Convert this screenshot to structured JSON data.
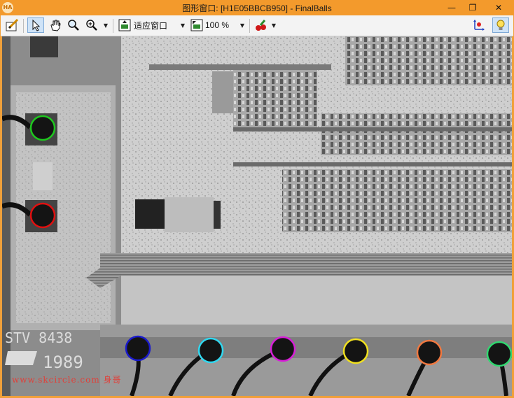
{
  "window": {
    "title": "图形窗口: [H1E05BBCB950] - FinalBalls",
    "app_icon": "HA",
    "controls": [
      "minimize-icon",
      "maximize-icon",
      "close-icon"
    ]
  },
  "toolbar": {
    "tools": [
      "edit-pen-icon",
      "pointer-icon",
      "hand-pan-icon",
      "magnifier-icon",
      "zoom-in-icon"
    ],
    "fit_mode": "适应窗口",
    "zoom": "100 %",
    "right_tools": [
      "axis-icon",
      "lightbulb-icon"
    ]
  },
  "image": {
    "marking_text": "STV 8438",
    "marking_year": "1989",
    "watermark": "www.skcircle.com 身哥",
    "circles": [
      {
        "color": "#1ec81e"
      },
      {
        "color": "#e01010"
      },
      {
        "color": "#1a1acc"
      },
      {
        "color": "#30d8f0"
      },
      {
        "color": "#d81ed8"
      },
      {
        "color": "#f0e020"
      },
      {
        "color": "#f07840"
      },
      {
        "color": "#30d870"
      }
    ]
  }
}
